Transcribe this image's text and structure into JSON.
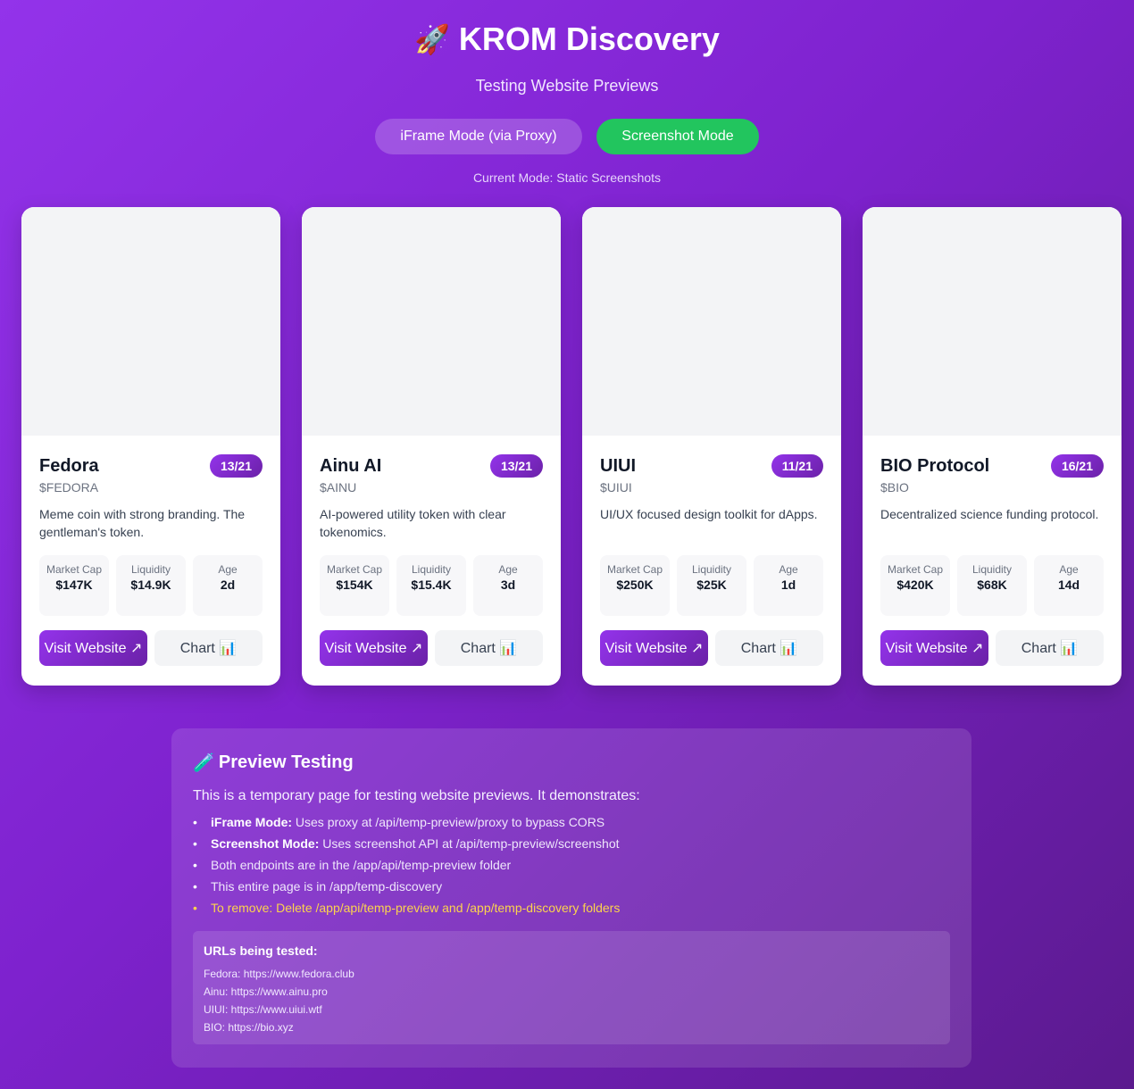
{
  "header": {
    "icon": "rocket-icon",
    "title": "KROM Discovery",
    "subtitle": "Testing Website Previews",
    "mode_iframe_label": "iFrame Mode (via Proxy)",
    "mode_screenshot_label": "Screenshot Mode",
    "current_mode": "Current Mode: Static Screenshots"
  },
  "cards": [
    {
      "name": "Fedora",
      "score": "13/21",
      "ticker": "$FEDORA",
      "description": "Meme coin with strong branding. The gentleman's token.",
      "market_cap_label": "Market Cap",
      "market_cap": "$147K",
      "liquidity_label": "Liquidity",
      "liquidity": "$14.9K",
      "age_label": "Age",
      "age": "2d",
      "visit_label": "Visit Website ↗",
      "chart_label": "Chart 📊"
    },
    {
      "name": "Ainu AI",
      "score": "13/21",
      "ticker": "$AINU",
      "description": "AI-powered utility token with clear tokenomics.",
      "market_cap_label": "Market Cap",
      "market_cap": "$154K",
      "liquidity_label": "Liquidity",
      "liquidity": "$15.4K",
      "age_label": "Age",
      "age": "3d",
      "visit_label": "Visit Website ↗",
      "chart_label": "Chart 📊"
    },
    {
      "name": "UIUI",
      "score": "11/21",
      "ticker": "$UIUI",
      "description": "UI/UX focused design toolkit for dApps.",
      "market_cap_label": "Market Cap",
      "market_cap": "$250K",
      "liquidity_label": "Liquidity",
      "liquidity": "$25K",
      "age_label": "Age",
      "age": "1d",
      "visit_label": "Visit Website ↗",
      "chart_label": "Chart 📊"
    },
    {
      "name": "BIO Protocol",
      "score": "16/21",
      "ticker": "$BIO",
      "description": "Decentralized science funding protocol.",
      "market_cap_label": "Market Cap",
      "market_cap": "$420K",
      "liquidity_label": "Liquidity",
      "liquidity": "$68K",
      "age_label": "Age",
      "age": "14d",
      "visit_label": "Visit Website ↗",
      "chart_label": "Chart 📊"
    }
  ],
  "info": {
    "icon": "test-tube-icon",
    "title": "Preview Testing",
    "intro": "This is a temporary page for testing website previews. It demonstrates:",
    "items": [
      {
        "bold": "iFrame Mode:",
        "text": " Uses proxy at /api/temp-preview/proxy to bypass CORS"
      },
      {
        "bold": "Screenshot Mode:",
        "text": " Uses screenshot API at /api/temp-preview/screenshot"
      },
      {
        "bold": "",
        "text": "Both endpoints are in the /app/api/temp-preview folder"
      },
      {
        "bold": "",
        "text": "This entire page is in /app/temp-discovery"
      },
      {
        "bold": "",
        "text": "To remove: Delete /app/api/temp-preview and /app/temp-discovery folders"
      }
    ],
    "urls_title": "URLs being tested:",
    "urls": [
      "Fedora: https://www.fedora.club",
      "Ainu: https://www.ainu.pro",
      "UIUI: https://www.uiui.wtf",
      "BIO: https://bio.xyz"
    ]
  },
  "colors": {
    "accent": "#9333ea",
    "active_mode": "#22c55e",
    "warning": "#fcd34d"
  }
}
